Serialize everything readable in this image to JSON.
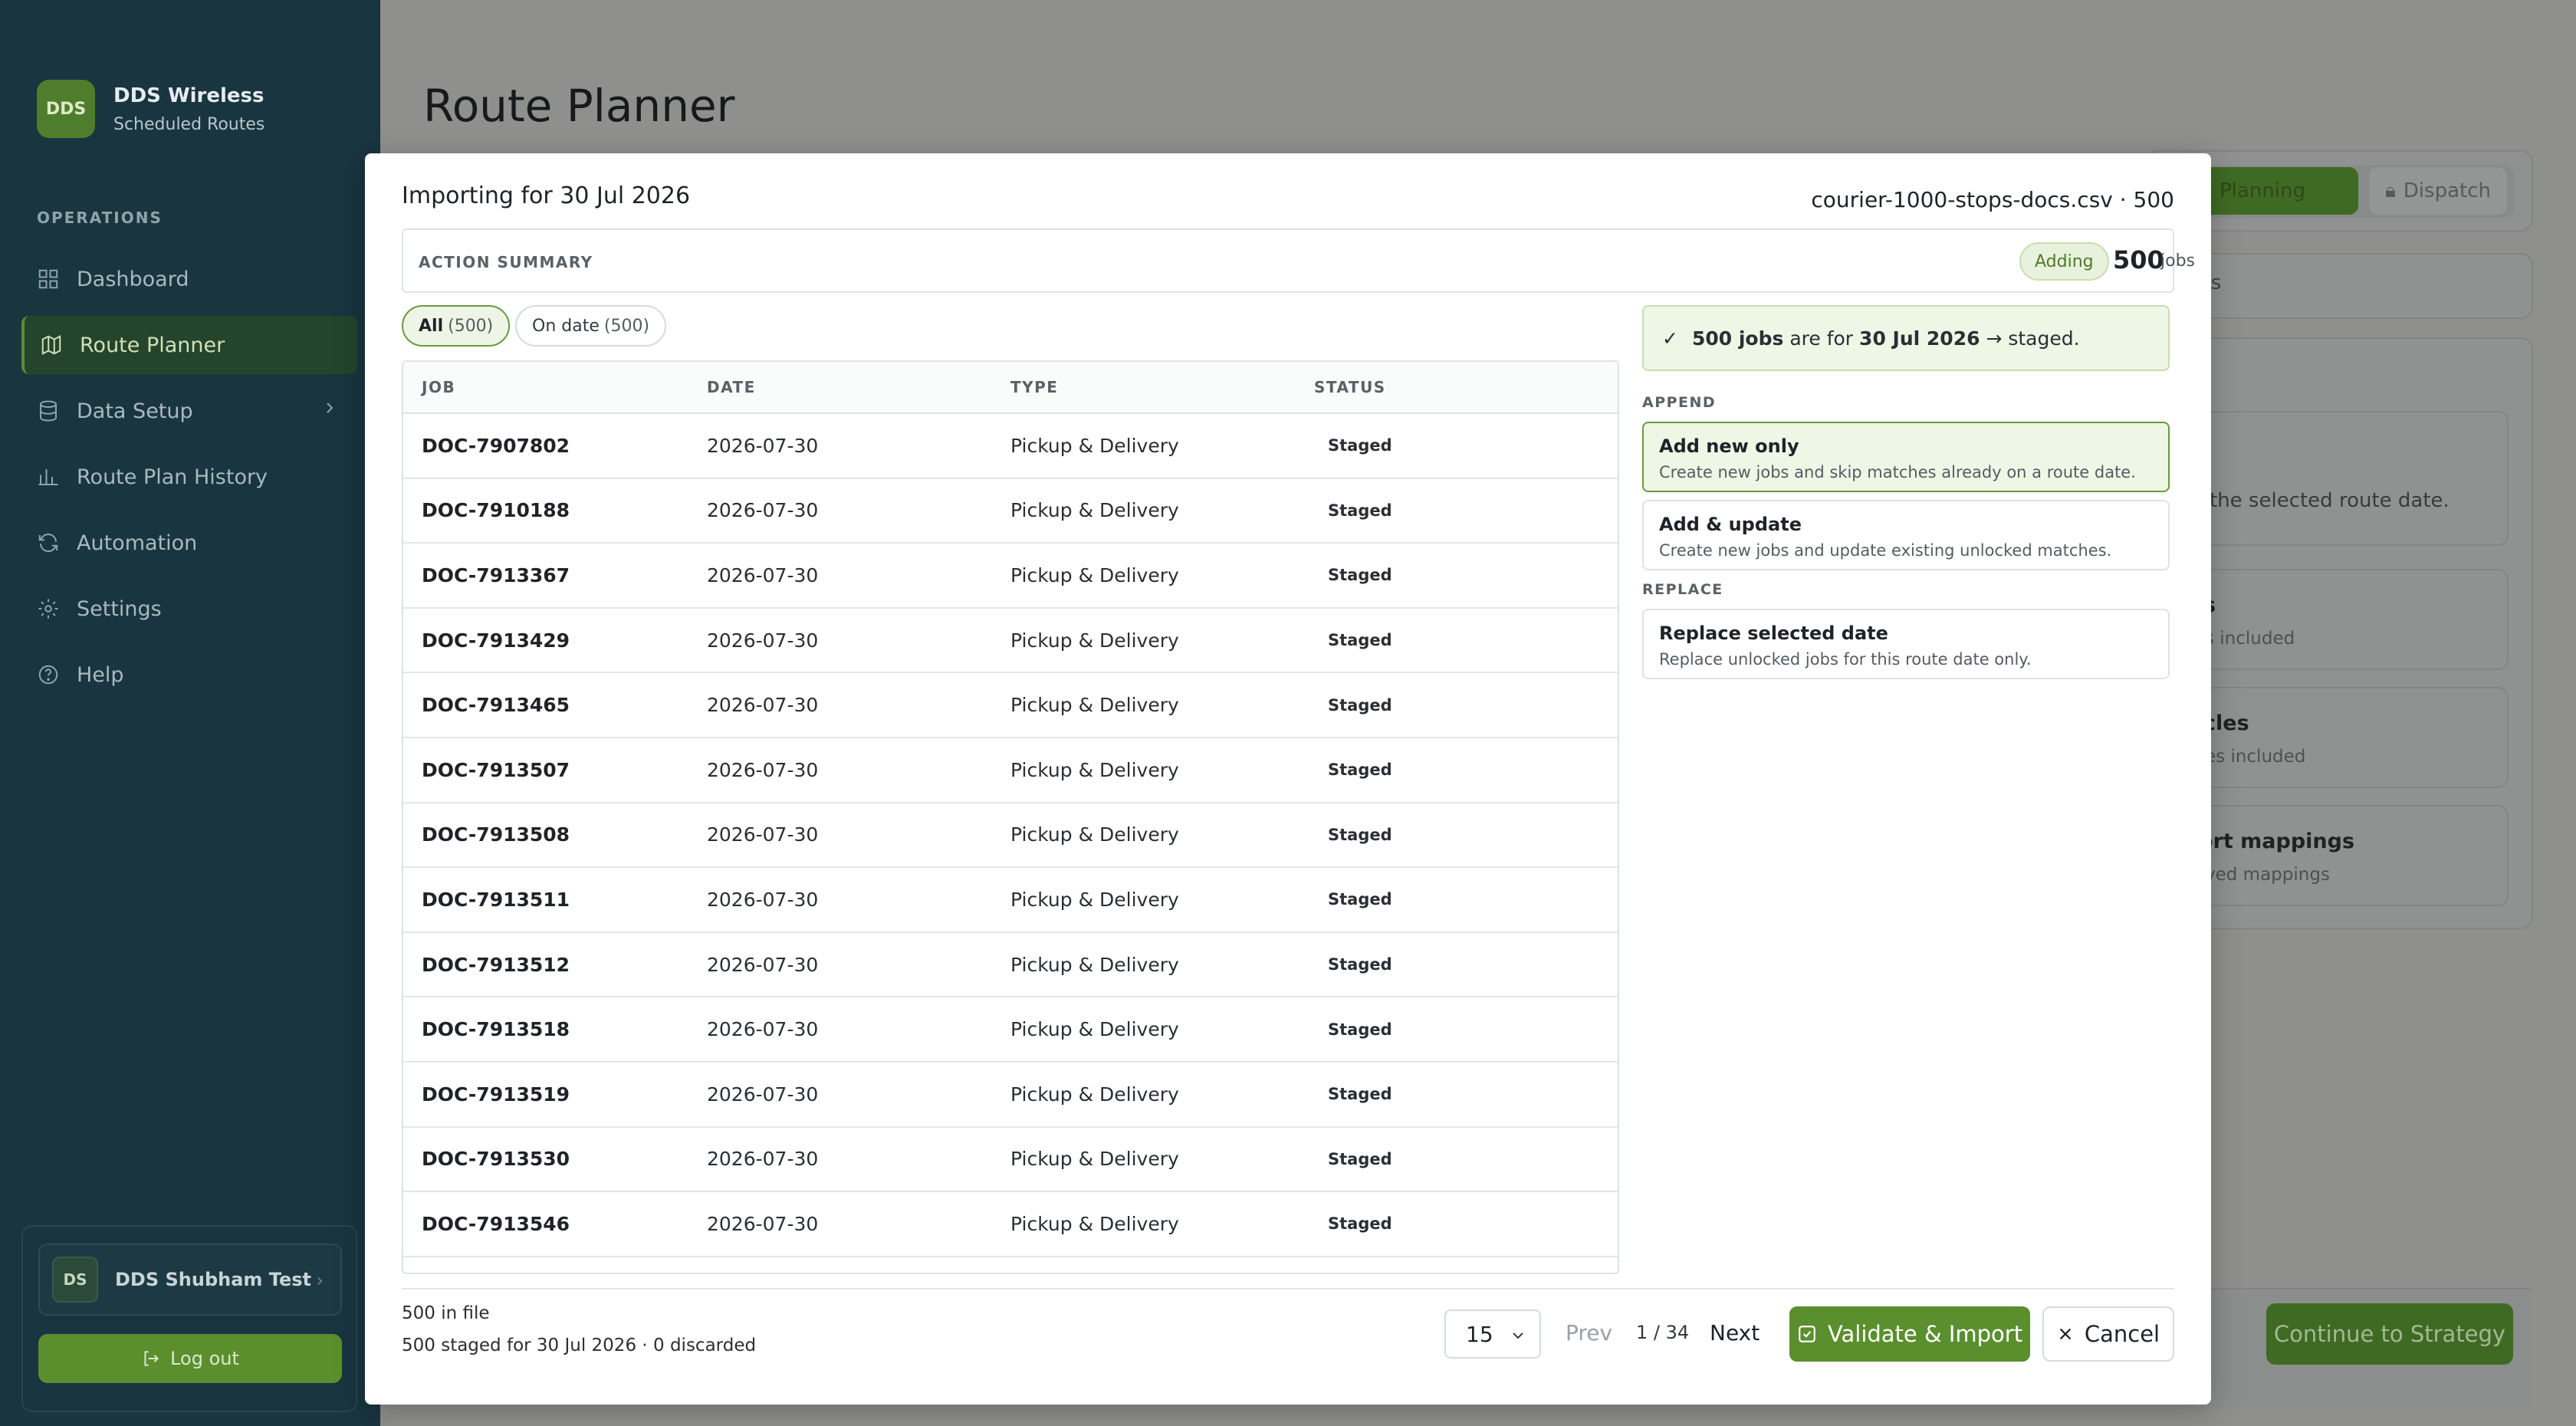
{
  "sidebar": {
    "brand_logo": "DDS",
    "brand_name": "DDS Wireless",
    "brand_sub": "Scheduled Routes",
    "section": "OPERATIONS",
    "items": [
      {
        "label": "Dashboard",
        "icon": "grid-icon"
      },
      {
        "label": "Route Planner",
        "icon": "map-icon",
        "active": true
      },
      {
        "label": "Data Setup",
        "icon": "database-icon"
      },
      {
        "label": "Route Plan History",
        "icon": "chart-icon"
      },
      {
        "label": "Automation",
        "icon": "refresh-icon"
      },
      {
        "label": "Settings",
        "icon": "gear-icon"
      },
      {
        "label": "Help",
        "icon": "help-icon"
      }
    ],
    "user_initials": "DS",
    "user_name": "DDS Shubham Test",
    "logout": "Log out"
  },
  "background": {
    "page_title": "Route Planner",
    "planning": "Planning",
    "dispatch": "Dispatch",
    "lists": "sts",
    "card1_text": "the selected route date.",
    "card2_title": "s",
    "card2_sub": "s included",
    "card3_title": "cles",
    "card3_sub": "es included",
    "card4_title": "ort mappings",
    "card4_sub": "ved mappings",
    "continue": "Continue to Strategy"
  },
  "modal": {
    "title": "Importing for 30 Jul 2026",
    "file": "courier-1000-stops-docs.csv · 500",
    "summary_label": "ACTION SUMMARY",
    "adding": "Adding",
    "count": "500",
    "count_unit": "jobs",
    "filters": [
      {
        "label": "All",
        "count": "(500)",
        "active": true
      },
      {
        "label": "On date",
        "count": "(500)",
        "active": false
      }
    ],
    "columns": [
      "JOB",
      "DATE",
      "TYPE",
      "STATUS"
    ],
    "rows": [
      {
        "job": "DOC-7907802",
        "date": "2026-07-30",
        "type": "Pickup & Delivery",
        "status": "Staged"
      },
      {
        "job": "DOC-7910188",
        "date": "2026-07-30",
        "type": "Pickup & Delivery",
        "status": "Staged"
      },
      {
        "job": "DOC-7913367",
        "date": "2026-07-30",
        "type": "Pickup & Delivery",
        "status": "Staged"
      },
      {
        "job": "DOC-7913429",
        "date": "2026-07-30",
        "type": "Pickup & Delivery",
        "status": "Staged"
      },
      {
        "job": "DOC-7913465",
        "date": "2026-07-30",
        "type": "Pickup & Delivery",
        "status": "Staged"
      },
      {
        "job": "DOC-7913507",
        "date": "2026-07-30",
        "type": "Pickup & Delivery",
        "status": "Staged"
      },
      {
        "job": "DOC-7913508",
        "date": "2026-07-30",
        "type": "Pickup & Delivery",
        "status": "Staged"
      },
      {
        "job": "DOC-7913511",
        "date": "2026-07-30",
        "type": "Pickup & Delivery",
        "status": "Staged"
      },
      {
        "job": "DOC-7913512",
        "date": "2026-07-30",
        "type": "Pickup & Delivery",
        "status": "Staged"
      },
      {
        "job": "DOC-7913518",
        "date": "2026-07-30",
        "type": "Pickup & Delivery",
        "status": "Staged"
      },
      {
        "job": "DOC-7913519",
        "date": "2026-07-30",
        "type": "Pickup & Delivery",
        "status": "Staged"
      },
      {
        "job": "DOC-7913530",
        "date": "2026-07-30",
        "type": "Pickup & Delivery",
        "status": "Staged"
      },
      {
        "job": "DOC-7913546",
        "date": "2026-07-30",
        "type": "Pickup & Delivery",
        "status": "Staged"
      }
    ],
    "notice": {
      "check": "✓",
      "count": "500 jobs",
      "mid": "are for",
      "date": "30 Jul 2026",
      "end": "→ staged."
    },
    "append_label": "APPEND",
    "replace_label": "REPLACE",
    "options": {
      "add_new": {
        "title": "Add new only",
        "desc": "Create new jobs and skip matches already on a route date.",
        "selected": true
      },
      "add_update": {
        "title": "Add & update",
        "desc": "Create new jobs and update existing unlocked matches."
      },
      "replace": {
        "title": "Replace selected date",
        "desc": "Replace unlocked jobs for this route date only."
      }
    },
    "footer": {
      "in_file": "500 in file",
      "staged": "500 staged for 30 Jul 2026 · 0 discarded",
      "page_size": "15",
      "prev": "Prev",
      "page": "1 / 34",
      "next": "Next",
      "validate": "Validate & Import",
      "cancel": "Cancel"
    }
  },
  "colors": {
    "accent": "#5b8f2e",
    "sidebar_bg": "#19353f",
    "overlay": "#8f8f8d"
  }
}
